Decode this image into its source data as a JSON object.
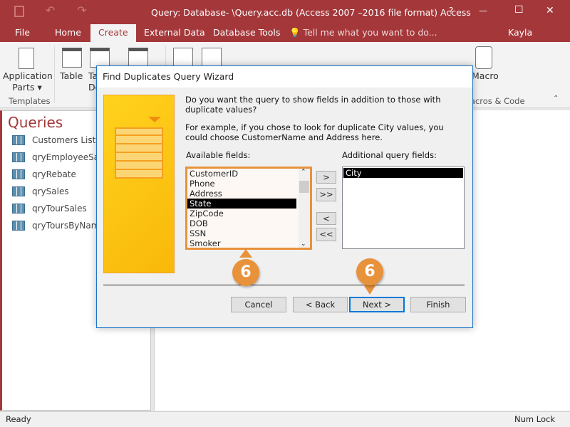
{
  "window": {
    "title": "Query: Database- \\Query.acc.db (Access 2007 –2016 file format) Access",
    "help": "?",
    "minimize": "—",
    "maximize": "☐",
    "close": "✕"
  },
  "tabs": [
    {
      "label": "File"
    },
    {
      "label": "Home"
    },
    {
      "label": "Create",
      "active": true
    },
    {
      "label": "External Data"
    },
    {
      "label": "Database Tools"
    }
  ],
  "tell_me": "Tell me what you want to do...",
  "user": "Kayla Claypool",
  "ribbon": {
    "app_parts": "Application Parts ▾",
    "templates_group": "Templates",
    "table": "Table",
    "table_design": "Table Design",
    "macro": "Macro",
    "macros_group": "Macros & Code"
  },
  "nav": {
    "title": "Queries",
    "items": [
      "Customers List",
      "qryEmployeeSales",
      "qryRebate",
      "qrySales",
      "qryTourSales",
      "qryToursByName"
    ]
  },
  "status": {
    "left": "Ready",
    "right": "Num Lock"
  },
  "dialog": {
    "title": "Find Duplicates Query Wizard",
    "question": "Do you want the query to show fields in addition to those with duplicate values?",
    "example": "For example, if you chose to look for duplicate City values, you could choose CustomerName and Address here.",
    "available_label": "Available fields:",
    "additional_label": "Additional query fields:",
    "available_fields": [
      "CustomerID",
      "Phone",
      "Address",
      "State",
      "ZipCode",
      "DOB",
      "SSN",
      "Smoker"
    ],
    "available_selected": "State",
    "additional_fields": [
      "City"
    ],
    "move_buttons": [
      ">",
      ">>",
      "<",
      "<<"
    ],
    "buttons": {
      "cancel": "Cancel",
      "back": "< Back",
      "next": "Next >",
      "finish": "Finish"
    }
  },
  "callouts": [
    "6",
    "6"
  ],
  "colors": {
    "accent": "#a4373a",
    "callout": "#e8923b",
    "focus": "#0078d7"
  }
}
